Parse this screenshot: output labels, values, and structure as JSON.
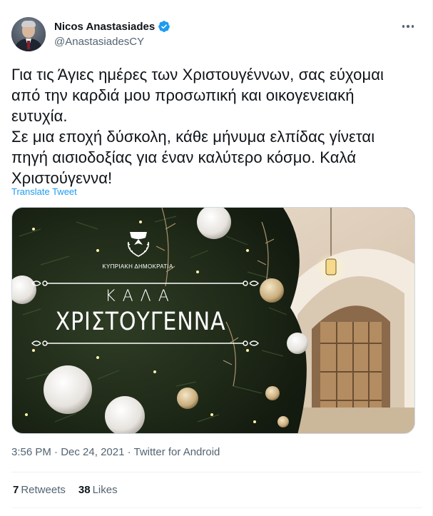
{
  "user": {
    "display_name": "Nicos Anastasiades",
    "handle": "@AnastasiadesCY",
    "verified": true
  },
  "tweet": {
    "text": "Για τις Άγιες ημέρες των Χριστουγέννων, σας εύχομαι\nαπό την καρδιά μου προσωπική και οικογενειακή\nευτυχία.\nΣε μια εποχή δύσκολη, κάθε μήνυμα ελπίδας γίνεται\nπηγή αισιοδοξίας για έναν καλύτερο κόσμο. Καλά\nΧριστούγεννα!",
    "translate_label": "Translate Tweet"
  },
  "media": {
    "republic_label": "ΚΥΠΡΙΑΚΗ ΔΗΜΟΚΡΑΤΙΑ",
    "greeting_line1": "ΚΑΛΑ",
    "greeting_line2": "ΧΡΙΣΤΟΥΓΕΝΝΑ"
  },
  "meta": {
    "time": "3:56 PM",
    "separator": " · ",
    "date": "Dec 24, 2021",
    "source": "Twitter for Android"
  },
  "stats": {
    "retweets_count": "7",
    "retweets_label": "Retweets",
    "likes_count": "38",
    "likes_label": "Likes"
  },
  "colors": {
    "accent": "#1d9bf0",
    "secondary_text": "#536471",
    "primary_text": "#0f1419"
  },
  "icons": {
    "verified": "verified-badge-icon",
    "more": "more-horizontal-icon"
  }
}
